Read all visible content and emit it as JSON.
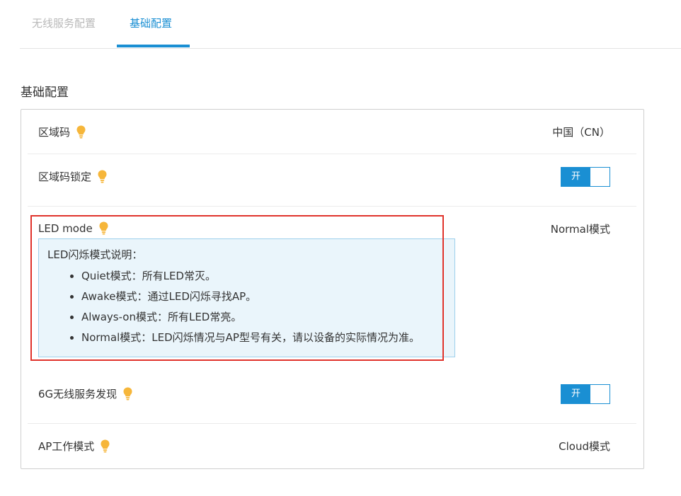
{
  "tabs": [
    {
      "label": "无线服务配置",
      "active": false
    },
    {
      "label": "基础配置",
      "active": true
    }
  ],
  "section_title": "基础配置",
  "rows": {
    "region_code": {
      "label": "区域码",
      "value": "中国（CN）"
    },
    "region_lock": {
      "label": "区域码锁定",
      "toggle_label": "开",
      "enabled": true
    },
    "led_mode": {
      "label": "LED mode",
      "value": "Normal模式"
    },
    "discovery_6g": {
      "label": "6G无线服务发现",
      "toggle_label": "开",
      "enabled": true
    },
    "ap_work_mode": {
      "label": "AP工作模式",
      "value": "Cloud模式"
    }
  },
  "led_tooltip": {
    "title": "LED闪烁模式说明：",
    "items": [
      "Quiet模式：所有LED常灭。",
      "Awake模式：通过LED闪烁寻找AP。",
      "Always-on模式：所有LED常亮。",
      "Normal模式：LED闪烁情况与AP型号有关，请以设备的实际情况为准。"
    ]
  },
  "colors": {
    "accent": "#1a8fd3",
    "bulb": "#f6b63a",
    "highlight": "#e0332b",
    "tooltip_bg": "#eaf5fb"
  },
  "icons": {
    "hint": "lightbulb-icon"
  }
}
